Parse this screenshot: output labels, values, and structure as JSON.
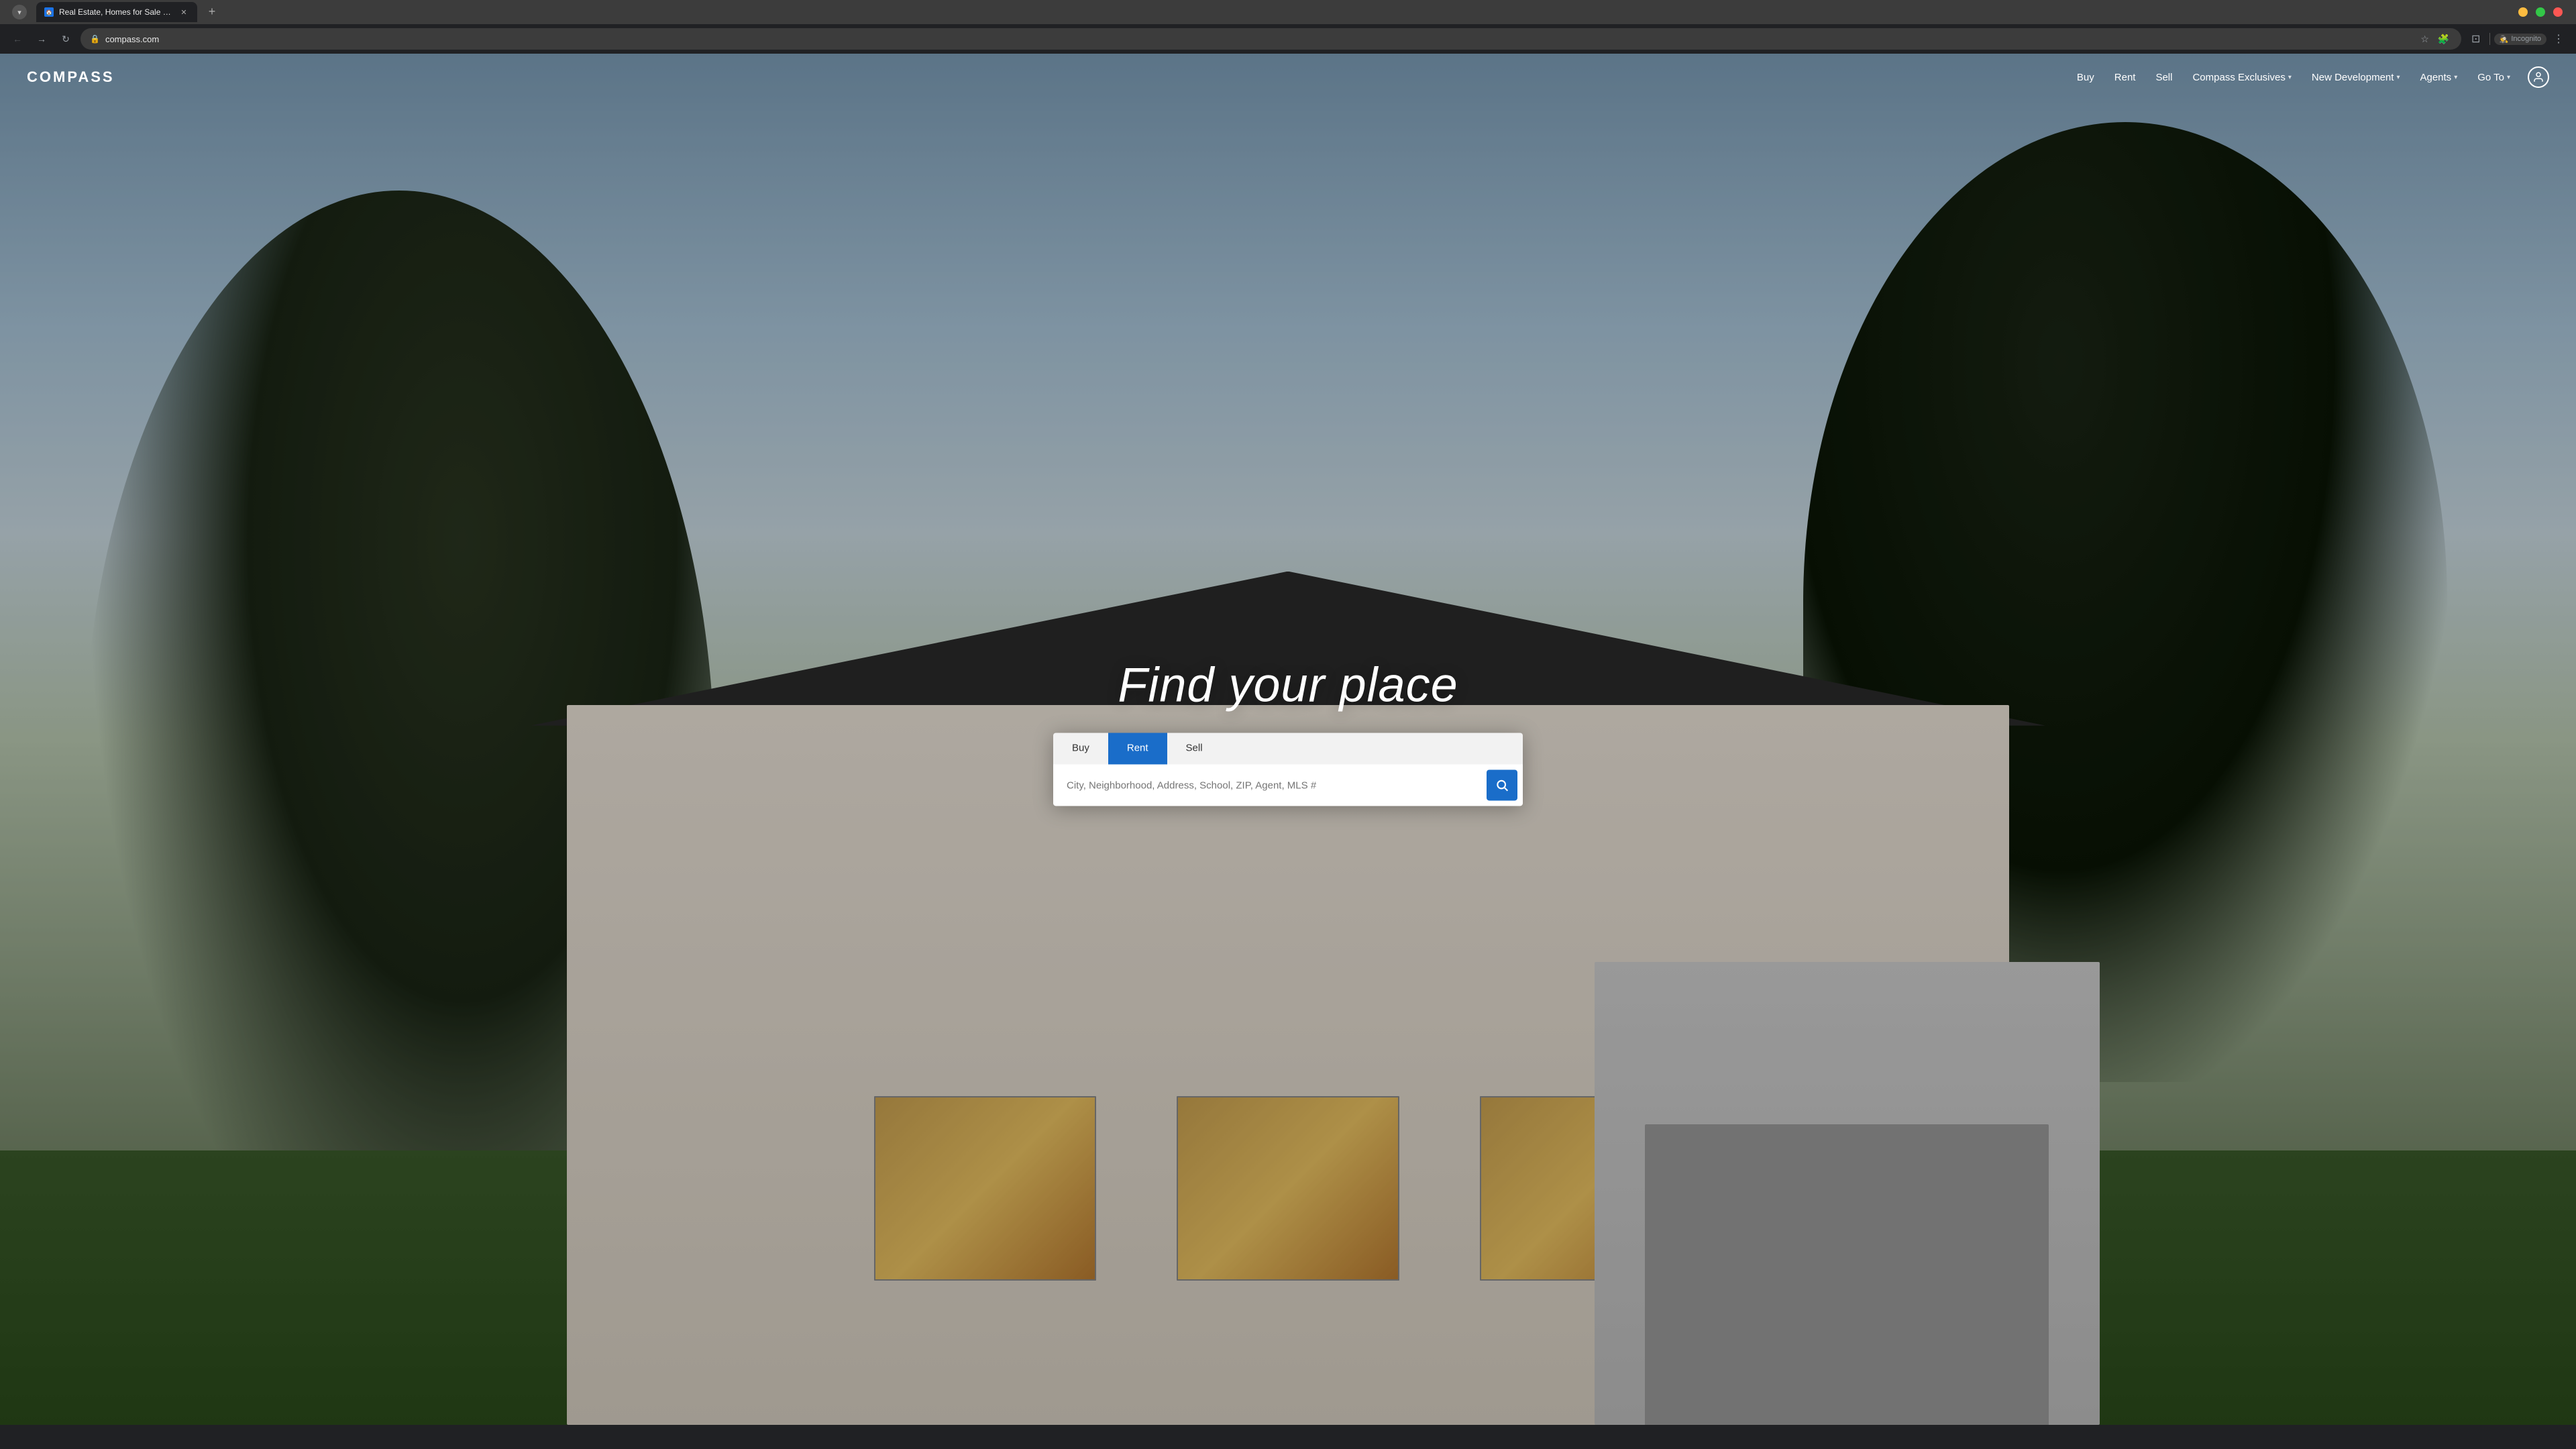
{
  "browser": {
    "tab_title": "Real Estate, Homes for Sale & ...",
    "tab_favicon": "🏠",
    "url": "compass.com",
    "new_tab_label": "+",
    "incognito_label": "Incognito",
    "nav": {
      "back_tooltip": "Back",
      "forward_tooltip": "Forward",
      "reload_tooltip": "Reload"
    }
  },
  "site": {
    "logo": "COMPASS",
    "nav": {
      "buy": "Buy",
      "rent": "Rent",
      "sell": "Sell",
      "compass_exclusives": "Compass Exclusives",
      "new_development": "New Development",
      "agents": "Agents",
      "go_to": "Go To"
    },
    "hero": {
      "title": "Find your place"
    },
    "search": {
      "tab_buy": "Buy",
      "tab_rent": "Rent",
      "tab_sell": "Sell",
      "active_tab": "rent",
      "placeholder": "City, Neighborhood, Address, School, ZIP, Agent, MLS #"
    }
  }
}
